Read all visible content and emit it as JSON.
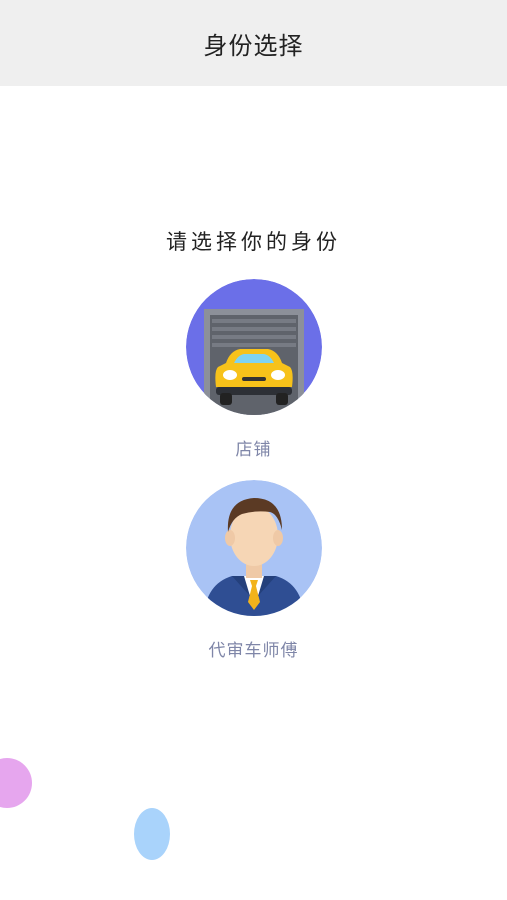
{
  "header": {
    "title": "身份选择"
  },
  "prompt": "请选择你的身份",
  "roles": [
    {
      "label": "店铺",
      "icon": "garage-car-icon",
      "circle_color": "#6b6fe8"
    },
    {
      "label": "代审车师傅",
      "icon": "man-in-suit-icon",
      "circle_color": "#a9c3f5"
    }
  ],
  "colors": {
    "header_bg": "#efefef",
    "label_color": "#7f86a8",
    "bubble_purple": "#e6a6ee",
    "bubble_blue": "#a9d3fb"
  }
}
